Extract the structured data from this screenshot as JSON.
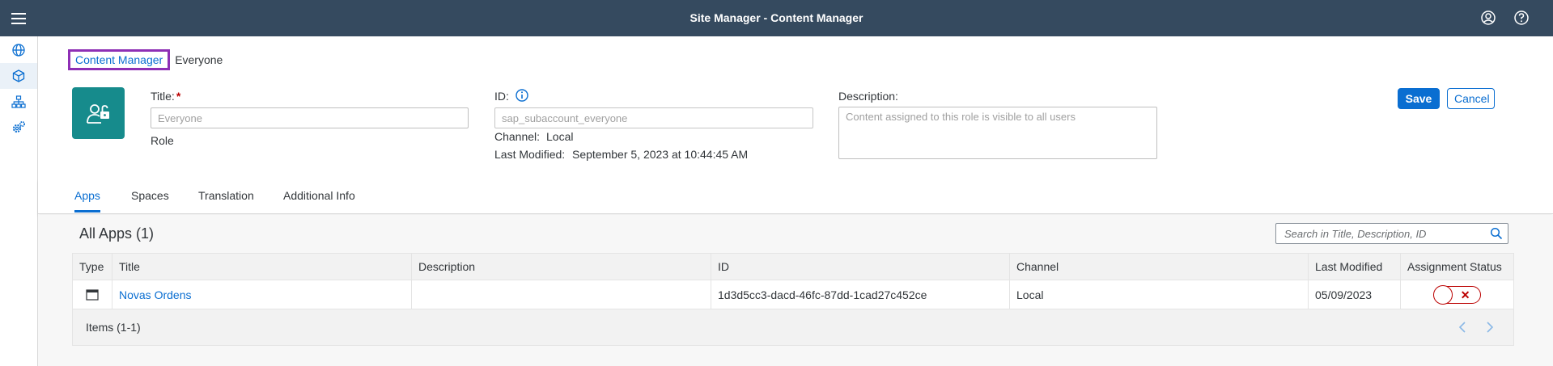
{
  "shell": {
    "title": "Site Manager - Content Manager",
    "menu_icon": "hamburger-menu-icon",
    "profile_icon": "user-profile-icon",
    "help_icon": "help-icon",
    "bg_color": "#354a5f"
  },
  "sidenav": {
    "items": [
      {
        "name": "sites",
        "icon": "globe-icon"
      },
      {
        "name": "content-manager",
        "icon": "cube-icon",
        "active": true
      },
      {
        "name": "hierarchy",
        "icon": "sitemap-icon"
      },
      {
        "name": "settings",
        "icon": "gears-icon"
      }
    ]
  },
  "breadcrumb": {
    "link": "Content Manager",
    "current": "Everyone"
  },
  "header": {
    "role_icon": "unlocked-user-icon",
    "role_icon_color": "#168b8c",
    "title_label": "Title:",
    "title_required": "*",
    "title_placeholder": "Everyone",
    "type_label": "Role",
    "id_label": "ID:",
    "id_value": "sap_subaccount_everyone",
    "channel_label": "Channel:",
    "channel_value": "Local",
    "modified_label": "Last Modified:",
    "modified_value": "September 5, 2023 at 10:44:45 AM",
    "description_label": "Description:",
    "description_placeholder": "Content assigned to this role is visible to all users",
    "save_label": "Save",
    "cancel_label": "Cancel"
  },
  "tabs": [
    {
      "label": "Apps",
      "active": true
    },
    {
      "label": "Spaces"
    },
    {
      "label": "Translation"
    },
    {
      "label": "Additional Info"
    }
  ],
  "apps": {
    "title": "All Apps (1)",
    "search_placeholder": "Search in Title, Description, ID",
    "columns": [
      "Type",
      "Title",
      "Description",
      "ID",
      "Channel",
      "Last Modified",
      "Assignment Status"
    ],
    "rows": [
      {
        "type_icon": "app-window-icon",
        "title": "Novas Ordens",
        "description": "",
        "id": "1d3d5cc3-dacd-46fc-87dd-1cad27c452ce",
        "channel": "Local",
        "last_modified": "05/09/2023",
        "assigned": false,
        "status_mark": "✕"
      }
    ],
    "items_label": "Items (1-1)"
  }
}
